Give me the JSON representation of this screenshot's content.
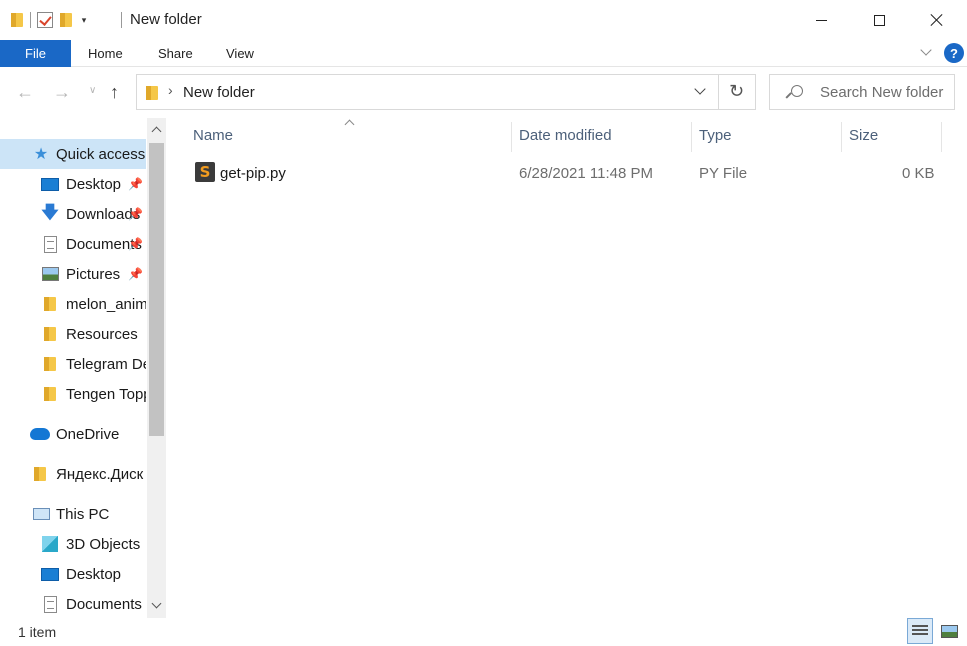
{
  "window": {
    "title": "New folder",
    "controls": [
      "minimize",
      "maximize",
      "close"
    ]
  },
  "ribbon": {
    "tabs": [
      {
        "label": "File",
        "active": true
      },
      {
        "label": "Home"
      },
      {
        "label": "Share"
      },
      {
        "label": "View"
      }
    ],
    "help_label": "?"
  },
  "address": {
    "path": [
      "New folder"
    ],
    "search_placeholder": "Search New folder"
  },
  "nav": {
    "items": [
      {
        "label": "Quick access",
        "icon": "star-icon",
        "selected": true
      },
      {
        "label": "Desktop",
        "icon": "desktop-icon",
        "pinned": true
      },
      {
        "label": "Downloads",
        "icon": "download-icon",
        "pinned": true
      },
      {
        "label": "Documents",
        "icon": "document-icon",
        "pinned": true
      },
      {
        "label": "Pictures",
        "icon": "pictures-icon",
        "pinned": true
      },
      {
        "label": "melon_animation",
        "icon": "folder-icon"
      },
      {
        "label": "Resources",
        "icon": "folder-icon"
      },
      {
        "label": "Telegram Desktop",
        "icon": "folder-icon"
      },
      {
        "label": "Tengen Toppa",
        "icon": "folder-icon"
      },
      {
        "label": "OneDrive",
        "icon": "onedrive-icon"
      },
      {
        "label": "Яндекс.Диск",
        "icon": "yandex-disk-icon"
      },
      {
        "label": "This PC",
        "icon": "pc-icon"
      },
      {
        "label": "3D Objects",
        "icon": "3d-objects-icon"
      },
      {
        "label": "Desktop",
        "icon": "desktop-icon"
      },
      {
        "label": "Documents",
        "icon": "document-icon"
      }
    ]
  },
  "table": {
    "columns": [
      "Name",
      "Date modified",
      "Type",
      "Size"
    ],
    "rows": [
      {
        "name": "get-pip.py",
        "date": "6/28/2021 11:48 PM",
        "type": "PY File",
        "size": "0 KB",
        "icon": "sublime-file-icon"
      }
    ]
  },
  "status": {
    "item_count": "1 item"
  },
  "colors": {
    "accent": "#1a68c6",
    "selection": "#cce4f7",
    "header_text": "#4c607a"
  }
}
